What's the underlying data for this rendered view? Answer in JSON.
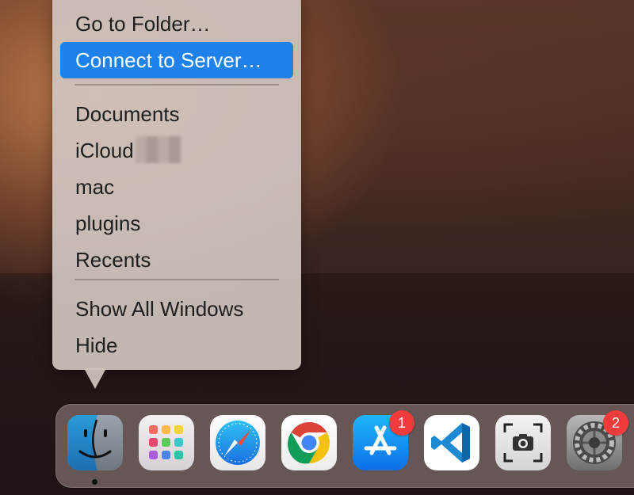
{
  "context_menu": {
    "items": [
      {
        "label": "Go to Folder…",
        "highlighted": false
      },
      {
        "label": "Connect to Server…",
        "highlighted": true
      },
      {
        "label": "Documents",
        "highlighted": false
      },
      {
        "label": "iCloud",
        "highlighted": false
      },
      {
        "label": "mac",
        "highlighted": false
      },
      {
        "label": "plugins",
        "highlighted": false
      },
      {
        "label": "Recents",
        "highlighted": false
      },
      {
        "label": "Show All Windows",
        "highlighted": false
      },
      {
        "label": "Hide",
        "highlighted": false
      }
    ]
  },
  "dock": {
    "apps": [
      {
        "name": "finder-icon",
        "running": true,
        "badge": ""
      },
      {
        "name": "launchpad-icon",
        "running": false,
        "badge": ""
      },
      {
        "name": "safari-icon",
        "running": false,
        "badge": ""
      },
      {
        "name": "chrome-icon",
        "running": false,
        "badge": ""
      },
      {
        "name": "app-store-icon",
        "running": false,
        "badge": "1"
      },
      {
        "name": "vscode-icon",
        "running": false,
        "badge": ""
      },
      {
        "name": "screenshot-icon",
        "running": false,
        "badge": ""
      },
      {
        "name": "system-preferences-icon",
        "running": false,
        "badge": "2"
      }
    ]
  },
  "colors": {
    "highlight": "#1e82ea",
    "badge": "#f23c3c"
  }
}
